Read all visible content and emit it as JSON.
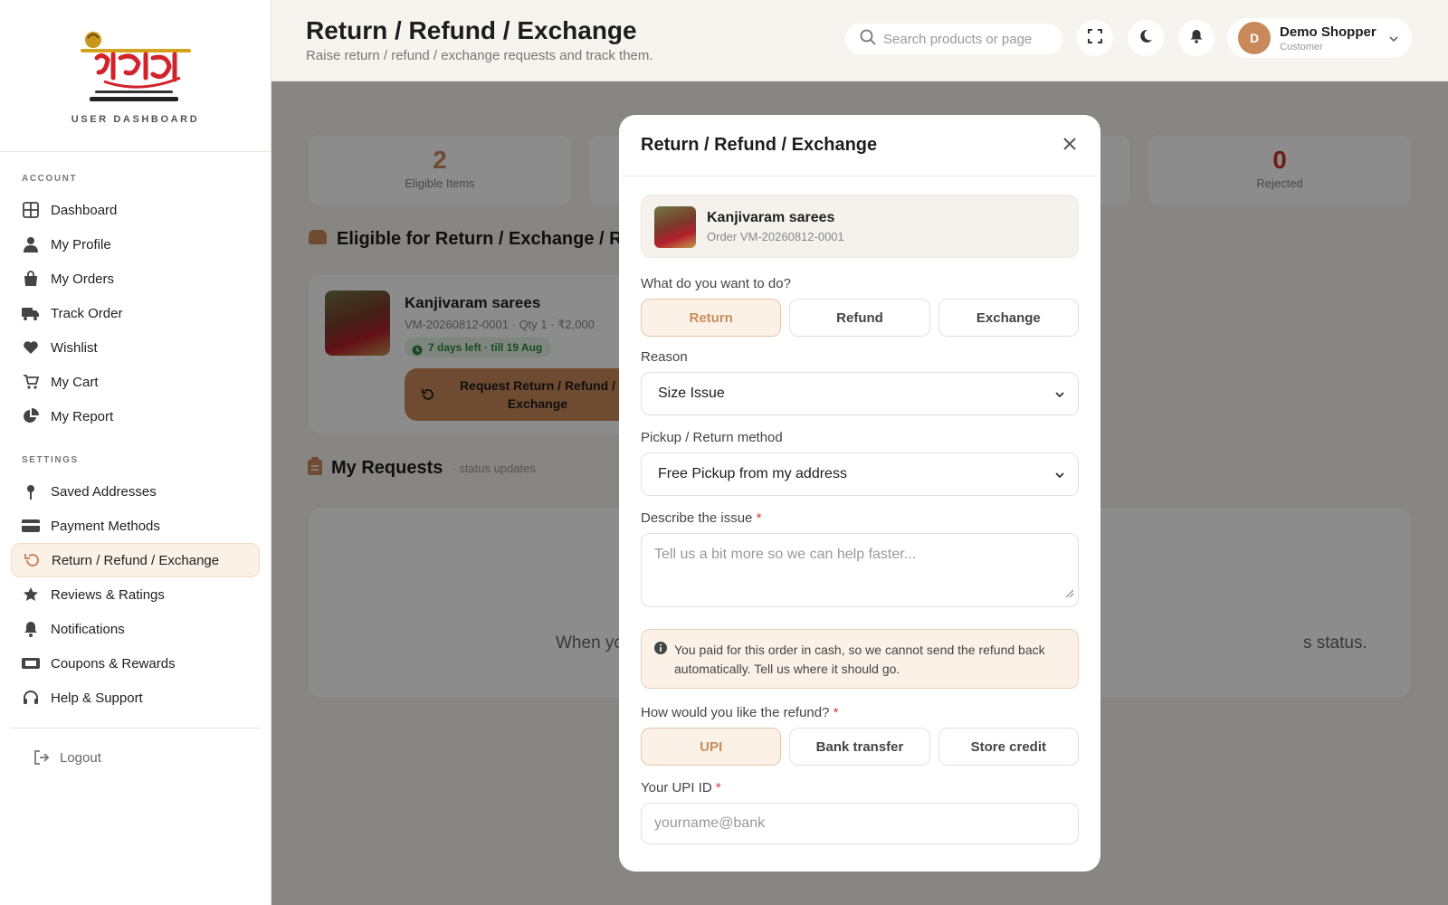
{
  "sidebar": {
    "brand_subtitle": "USER DASHBOARD",
    "account_title": "ACCOUNT",
    "account_items": [
      {
        "label": "Dashboard",
        "icon": "grid-icon"
      },
      {
        "label": "My Profile",
        "icon": "user-icon"
      },
      {
        "label": "My Orders",
        "icon": "bag-icon"
      },
      {
        "label": "Track Order",
        "icon": "truck-icon"
      },
      {
        "label": "Wishlist",
        "icon": "heart-icon"
      },
      {
        "label": "My Cart",
        "icon": "cart-icon"
      },
      {
        "label": "My Report",
        "icon": "pie-chart-icon"
      }
    ],
    "settings_title": "SETTINGS",
    "settings_items": [
      {
        "label": "Saved Addresses",
        "icon": "map-pin-icon"
      },
      {
        "label": "Payment Methods",
        "icon": "credit-card-icon"
      },
      {
        "label": "Return / Refund / Exchange",
        "icon": "undo-icon",
        "active": true
      },
      {
        "label": "Reviews & Ratings",
        "icon": "star-icon"
      },
      {
        "label": "Notifications",
        "icon": "bell-icon"
      },
      {
        "label": "Coupons & Rewards",
        "icon": "ticket-icon"
      },
      {
        "label": "Help & Support",
        "icon": "headset-icon"
      }
    ],
    "logout_label": "Logout"
  },
  "header": {
    "title": "Return / Refund / Exchange",
    "subtitle": "Raise return / refund / exchange requests and track them.",
    "search_placeholder": "Search products or page",
    "user_initial": "D",
    "user_name": "Demo Shopper",
    "user_role": "Customer"
  },
  "stats": [
    {
      "value": "2",
      "label": "Eligible Items",
      "color": "#c9895a"
    },
    {
      "value": "0",
      "label": "Rejected",
      "color": "#c0392b"
    }
  ],
  "eligible_section": {
    "title": "Eligible for Return / Exchange / Re",
    "item": {
      "name": "Kanjivaram sarees",
      "meta": "VM-20260812-0001 · Qty 1 · ₹2,000",
      "badge": "7 days left · till 19 Aug",
      "button_label": "Request Return / Refund / Exchange"
    }
  },
  "requests_section": {
    "title": "My Requests",
    "subtitle": "· status updates",
    "empty_left": "When yo",
    "empty_right": "s status."
  },
  "modal": {
    "title": "Return / Refund / Exchange",
    "product_name": "Kanjivaram sarees",
    "product_order": "Order VM-20260812-0001",
    "action_label": "What do you want to do?",
    "actions": [
      "Return",
      "Refund",
      "Exchange"
    ],
    "selected_action": "Return",
    "reason_label": "Reason",
    "reason_value": "Size Issue",
    "method_label": "Pickup / Return method",
    "method_value": "Free Pickup from my address",
    "describe_label": "Describe the issue",
    "describe_placeholder": "Tell us a bit more so we can help faster...",
    "cash_note": "You paid for this order in cash, so we cannot send the refund back automatically. Tell us where it should go.",
    "refund_label": "How would you like the refund?",
    "refund_options": [
      "UPI",
      "Bank transfer",
      "Store credit"
    ],
    "selected_refund": "UPI",
    "upi_label": "Your UPI ID",
    "upi_placeholder": "yourname@bank",
    "required_mark": "*"
  },
  "colors": {
    "accent": "#c9895a",
    "accent_light": "#fbf1e7",
    "success": "#2e8b3b",
    "danger": "#c0392b"
  }
}
